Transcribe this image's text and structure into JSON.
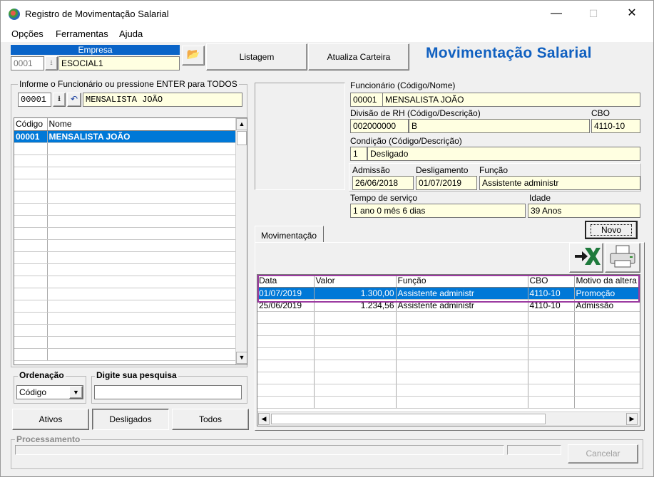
{
  "window": {
    "title": "Registro de Movimentação Salarial",
    "minimize": "—",
    "maximize": "☐",
    "close": "✕"
  },
  "menu": [
    "Opções",
    "Ferramentas",
    "Ajuda"
  ],
  "empresa": {
    "label": "Empresa",
    "code": "0001",
    "name": "ESOCIAL1"
  },
  "toolbar": {
    "listagem": "Listagem",
    "atualiza": "Atualiza Carteira"
  },
  "heading": "Movimentação Salarial",
  "left": {
    "group_label": "Informe o Funcionário ou pressione ENTER para TODOS",
    "emp_code": "00001",
    "emp_name": "MENSALISTA JOÃO",
    "grid_headers": [
      "Código",
      "Nome"
    ],
    "rows": [
      {
        "code": "00001",
        "name": "MENSALISTA JOÃO"
      }
    ],
    "ordenacao_label": "Ordenação",
    "ordenacao_value": "Código",
    "pesquisa_label": "Digite sua pesquisa",
    "pesquisa_value": "",
    "tabs": [
      "Ativos",
      "Desligados",
      "Todos"
    ]
  },
  "details": {
    "funcionario_label": "Funcionário (Código/Nome)",
    "funcionario_code": "00001",
    "funcionario_name": "MENSALISTA JOÃO",
    "divisao_label": "Divisão de RH (Código/Descrição)",
    "divisao_code": "002000000",
    "divisao_desc": "B",
    "cbo_label": "CBO",
    "cbo_value": "4110-10",
    "condicao_label": "Condição (Código/Descrição)",
    "condicao_code": "1",
    "condicao_desc": "Desligado",
    "admissao_label": "Admissão",
    "admissao_value": "26/06/2018",
    "desligamento_label": "Desligamento",
    "desligamento_value": "01/07/2019",
    "funcao_label": "Função",
    "funcao_value": "Assistente administr",
    "tempo_label": "Tempo de serviço",
    "tempo_value": "1 ano 0 mês 6 dias",
    "idade_label": "Idade",
    "idade_value": "39 Anos"
  },
  "movimentacao": {
    "tab": "Movimentação",
    "novo": "Novo",
    "headers": [
      "Data",
      "Valor",
      "Função",
      "CBO",
      "Motivo da altera"
    ],
    "rows": [
      {
        "data": "01/07/2019",
        "valor": "1.300,00",
        "funcao": "Assistente administr",
        "cbo": "4110-10",
        "motivo": "Promoção"
      },
      {
        "data": "25/06/2019",
        "valor": "1.234,56",
        "funcao": "Assistente administr",
        "cbo": "4110-10",
        "motivo": "Admissão"
      }
    ]
  },
  "footer": {
    "processamento_label": "Processamento",
    "cancelar": "Cancelar"
  },
  "colors": {
    "heading": "#1060c0",
    "selection": "#0078d7",
    "field": "#ffffe1",
    "highlight_border": "#9b3aa0"
  }
}
